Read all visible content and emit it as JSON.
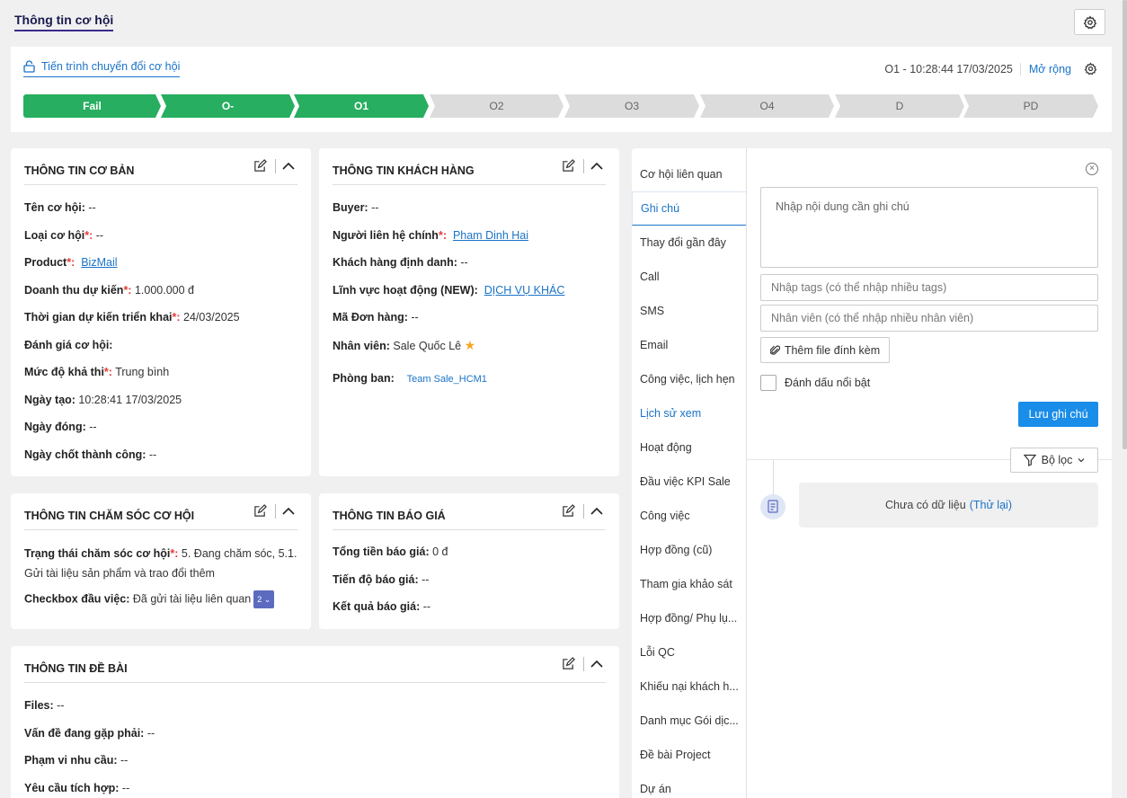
{
  "page": {
    "title": "Thông tin cơ hội"
  },
  "process": {
    "link_label": "Tiến trình chuyển đổi cơ hội",
    "stamp": "O1 - 10:28:44 17/03/2025",
    "expand_label": "Mở rộng",
    "steps": [
      {
        "label": "Fail",
        "state": "done"
      },
      {
        "label": "O-",
        "state": "done"
      },
      {
        "label": "O1",
        "state": "done"
      },
      {
        "label": "O2",
        "state": "todo"
      },
      {
        "label": "O3",
        "state": "todo"
      },
      {
        "label": "O4",
        "state": "todo"
      },
      {
        "label": "D",
        "state": "todo"
      },
      {
        "label": "PD",
        "state": "todo"
      }
    ]
  },
  "basic": {
    "title": "THÔNG TIN CƠ BẢN",
    "name_label": "Tên cơ hội:",
    "name_value": " --",
    "type_label": "Loại cơ hội",
    "type_value": " --",
    "product_label": "Product",
    "product_value": "BizMail",
    "revenue_label": "Doanh thu dự kiến",
    "revenue_value": " 1.000.000 đ",
    "deploy_label": "Thời gian dự kiến triển khai",
    "deploy_value": " 24/03/2025",
    "rating_label": "Đánh giá cơ hội:",
    "feasibility_label": "Mức độ khả thi",
    "feasibility_value": " Trung bình",
    "created_label": "Ngày tạo:",
    "created_value": " 10:28:41 17/03/2025",
    "closed_label": "Ngày đóng:",
    "closed_value": " --",
    "won_label": "Ngày chốt thành công:",
    "won_value": " --"
  },
  "customer": {
    "title": "THÔNG TIN KHÁCH HÀNG",
    "buyer_label": "Buyer:",
    "buyer_value": " --",
    "contact_label": "Người liên hệ chính",
    "contact_value": "Pham Dinh Hai",
    "identified_label": "Khách hàng định danh:",
    "identified_value": " --",
    "field_label": "Lĩnh vực hoạt động (NEW):",
    "field_value": "DỊCH VỤ KHÁC",
    "order_label": "Mã Đơn hàng:",
    "order_value": " --",
    "staff_label": "Nhân viên:",
    "staff_value": " Sale Quốc Lê",
    "dept_label": "Phòng ban:",
    "dept_value": "Team Sale_HCM1"
  },
  "care": {
    "title": "THÔNG TIN CHĂM SÓC CƠ HỘI",
    "status_label": "Trạng thái chăm sóc cơ hội",
    "status_value": " 5. Đang chăm sóc, 5.1.",
    "status_value2": "Gửi tài liệu sản phẩm và trao đổi thêm",
    "checkbox_label": "Checkbox đầu việc:",
    "checkbox_value": " Đã gửi tài liệu liên quan",
    "checkbox_badge": "2"
  },
  "quote": {
    "title": "THÔNG TIN BÁO GIÁ",
    "total_label": "Tổng tiền báo giá:",
    "total_value": " 0 đ",
    "progress_label": "Tiến độ báo giá:",
    "progress_value": " --",
    "result_label": "Kết quả báo giá:",
    "result_value": " --"
  },
  "brief": {
    "title": "THÔNG TIN ĐỀ BÀI",
    "files_label": "Files:",
    "files_value": " --",
    "issue_label": "Vấn đề đang gặp phải:",
    "issue_value": " --",
    "scope_label": "Phạm vi nhu cầu:",
    "scope_value": " --",
    "integration_label": "Yêu cầu tích hợp:",
    "integration_value": " --"
  },
  "tabs": [
    "Cơ hội liên quan",
    "Ghi chú",
    "Thay đổi gần đây",
    "Call",
    "SMS",
    "Email",
    "Công việc, lịch hẹn",
    "Lịch sử xem",
    "Hoạt động",
    "Đầu việc KPI Sale",
    "Công việc",
    "Hợp đồng (cũ)",
    "Tham gia khảo sát",
    "Hợp đồng/ Phụ lụ...",
    "Lỗi QC",
    "Khiếu nại khách h...",
    "Danh mục Gói dịc...",
    "Đề bài Project",
    "Dự án"
  ],
  "note": {
    "placeholder": "Nhập nội dung cần ghi chú",
    "tags_placeholder": "Nhập tags (có thể nhập nhiều tags)",
    "staff_placeholder": "Nhân viên (có thể nhập nhiều nhân viên)",
    "attach_label": "Thêm file đính kèm",
    "highlight_label": "Đánh dấu nổi bật",
    "save_label": "Lưu ghi chú",
    "filter_label": "Bộ lọc",
    "empty_text": "Chưa có dữ liệu",
    "retry_label": "(Thử lại)"
  },
  "colors": {
    "accent": "#1a73c8",
    "done_step": "#27ae60",
    "todo_step": "#dcdcdc",
    "save_button": "#1a8de9",
    "required": "#e53935"
  }
}
